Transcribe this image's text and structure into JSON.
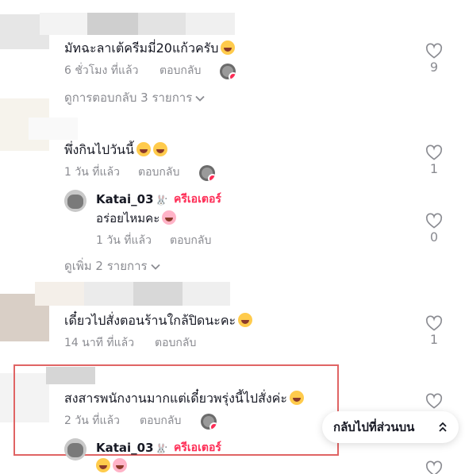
{
  "labels": {
    "reply": "ตอบกลับ",
    "creator": "ครีเอเตอร์",
    "back_to_top": "กลับไปที่ส่วนบน"
  },
  "comments": [
    {
      "text": "มัทฉะลาเต้ครีมมี่20แก้วครับ",
      "time": "6 ชั่วโมง ที่แล้ว",
      "likes": "9",
      "view_replies": "ดูการตอบกลับ 3 รายการ"
    },
    {
      "text": "พึ่งกินไปวันนี้",
      "time": "1 วัน ที่แล้ว",
      "likes": "1",
      "view_more": "ดูเพิ่ม 2 รายการ",
      "reply": {
        "username": "Katai_03",
        "text": "อร่อยไหมคะ",
        "time": "1 วัน ที่แล้ว",
        "likes": "0"
      }
    },
    {
      "text": "เดี๋ยวไปสั่งตอนร้านใกล้ปิดนะคะ",
      "time": "14 นาที ที่แล้ว",
      "likes": "1"
    },
    {
      "text": "สงสารพนักงานมากแต่เดี๋ยวพรุ่งนี้ไปสั่งค่ะ",
      "time": "2 วัน ที่แล้ว",
      "reply": {
        "username": "Katai_03"
      }
    }
  ],
  "colors": {
    "accent": "#fe2c55",
    "muted": "#8a8b91",
    "highlight": "#e06464"
  },
  "icons": [
    "heart-outline-icon",
    "chevron-down-icon",
    "chevron-up-icon",
    "heart-badge-icon",
    "emoji-icon",
    "bunny-icon"
  ]
}
